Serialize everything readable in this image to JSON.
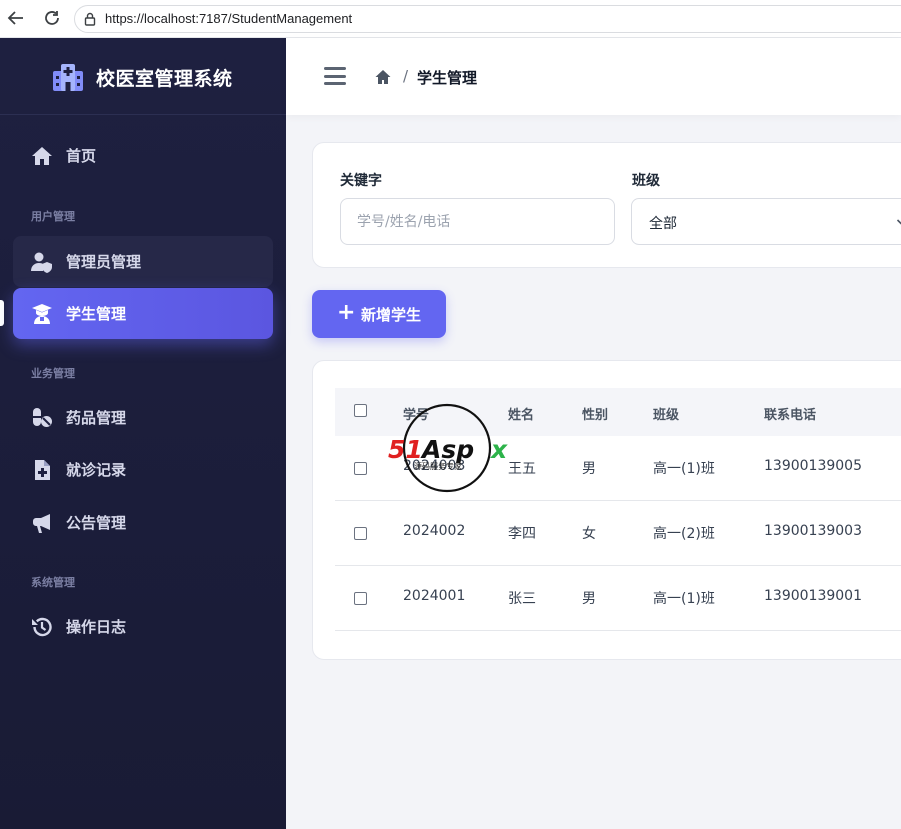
{
  "browser": {
    "url": "https://localhost:7187/StudentManagement"
  },
  "sidebar": {
    "brand_title": "校医室管理系统",
    "home_label": "首页",
    "sections": {
      "user": "用户管理",
      "business": "业务管理",
      "system": "系统管理"
    },
    "items": {
      "admin": "管理员管理",
      "student": "学生管理",
      "medicine": "药品管理",
      "visits": "就诊记录",
      "notices": "公告管理",
      "logs": "操作日志"
    },
    "active_item": "student"
  },
  "header": {
    "breadcrumb_separator": "/",
    "breadcrumb_current": "学生管理"
  },
  "filters": {
    "keyword_label": "关键字",
    "keyword_placeholder": "学号/姓名/电话",
    "keyword_value": "",
    "class_label": "班级",
    "class_value": "全部"
  },
  "actions": {
    "add_plus": "+",
    "add_label": "新增学生"
  },
  "table": {
    "columns": [
      "学号",
      "姓名",
      "性别",
      "班级",
      "联系电话"
    ],
    "rows": [
      [
        "2024003",
        "王五",
        "男",
        "高一(1)班",
        "13900139005"
      ],
      [
        "2024002",
        "李四",
        "女",
        "高一(2)班",
        "13900139003"
      ],
      [
        "2024001",
        "张三",
        "男",
        "高一(1)班",
        "13900139001"
      ]
    ]
  },
  "watermark": {
    "brand": "51Aspx",
    "tagline": "源码服务专家"
  },
  "colors": {
    "accent": "#6366f1",
    "sidebar_bg": "#1e2040",
    "watermark_red": "#e02020",
    "watermark_green": "#2db34a"
  }
}
